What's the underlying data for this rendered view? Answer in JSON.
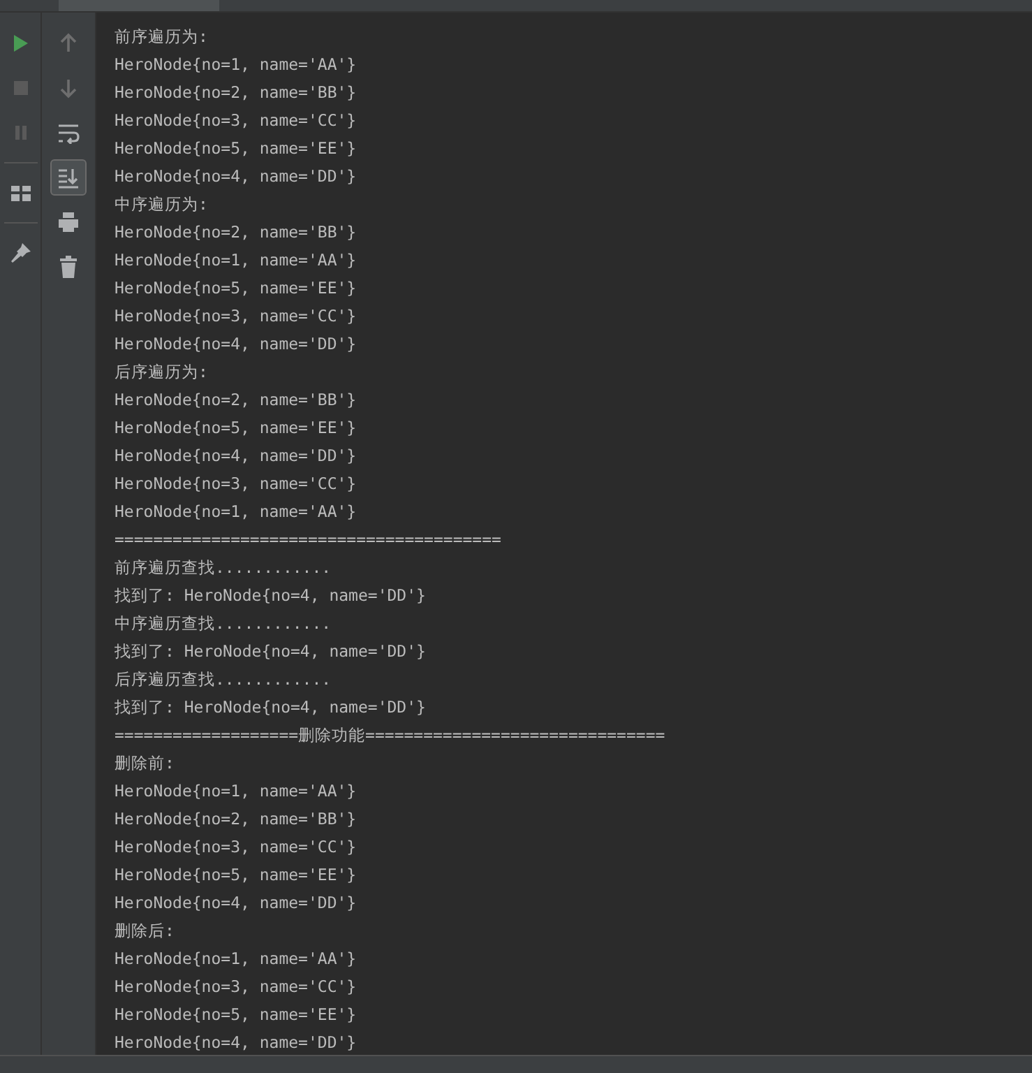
{
  "left_toolbar": [
    {
      "kind": "run",
      "disabled": false
    },
    {
      "kind": "stop",
      "disabled": true
    },
    {
      "kind": "pause",
      "disabled": true
    },
    {
      "kind": "layout",
      "disabled": false
    },
    {
      "kind": "pin",
      "disabled": false
    }
  ],
  "right_toolbar": [
    {
      "kind": "up",
      "selected": false
    },
    {
      "kind": "down",
      "selected": false
    },
    {
      "kind": "wrap",
      "selected": false
    },
    {
      "kind": "scroll-end",
      "selected": true
    },
    {
      "kind": "print",
      "selected": false
    },
    {
      "kind": "trash",
      "selected": false
    }
  ],
  "console": {
    "lines": [
      "前序遍历为:",
      "HeroNode{no=1, name='AA'}",
      "HeroNode{no=2, name='BB'}",
      "HeroNode{no=3, name='CC'}",
      "HeroNode{no=5, name='EE'}",
      "HeroNode{no=4, name='DD'}",
      "中序遍历为:",
      "HeroNode{no=2, name='BB'}",
      "HeroNode{no=1, name='AA'}",
      "HeroNode{no=5, name='EE'}",
      "HeroNode{no=3, name='CC'}",
      "HeroNode{no=4, name='DD'}",
      "后序遍历为:",
      "HeroNode{no=2, name='BB'}",
      "HeroNode{no=5, name='EE'}",
      "HeroNode{no=4, name='DD'}",
      "HeroNode{no=3, name='CC'}",
      "HeroNode{no=1, name='AA'}",
      "========================================",
      "前序遍历查找............",
      "找到了: HeroNode{no=4, name='DD'}",
      "中序遍历查找............",
      "找到了: HeroNode{no=4, name='DD'}",
      "后序遍历查找............",
      "找到了: HeroNode{no=4, name='DD'}",
      "===================删除功能===============================",
      "删除前:",
      "HeroNode{no=1, name='AA'}",
      "HeroNode{no=2, name='BB'}",
      "HeroNode{no=3, name='CC'}",
      "HeroNode{no=5, name='EE'}",
      "HeroNode{no=4, name='DD'}",
      "删除后:",
      "HeroNode{no=1, name='AA'}",
      "HeroNode{no=3, name='CC'}",
      "HeroNode{no=5, name='EE'}",
      "HeroNode{no=4, name='DD'}"
    ]
  }
}
